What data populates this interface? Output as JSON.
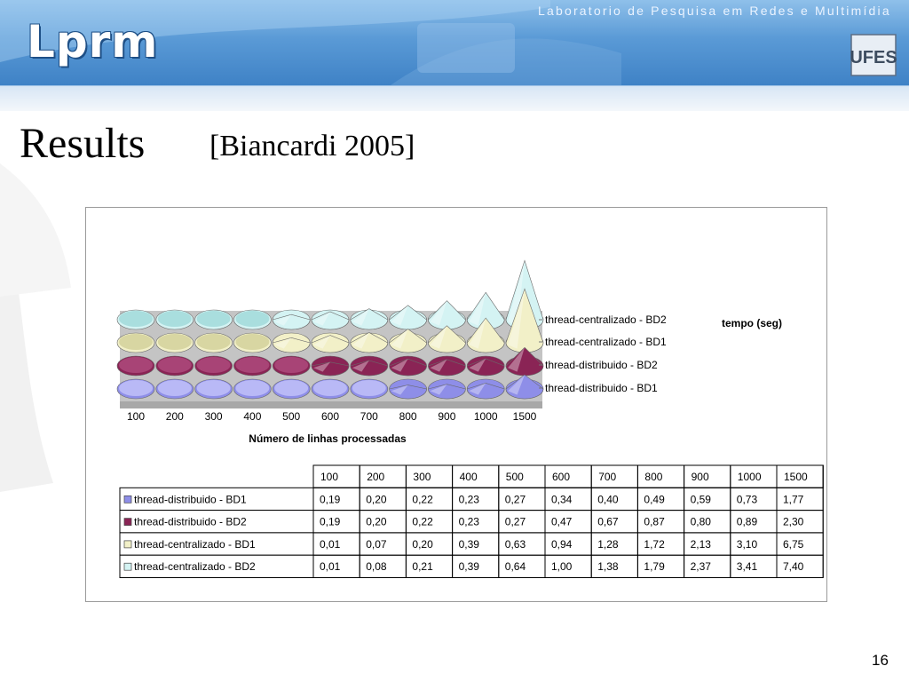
{
  "header": {
    "lab_name": "Laboratorio de Pesquisa em Redes e Multimídia",
    "logo_text": "Lprm",
    "ufes_logo": "UFES"
  },
  "slide": {
    "title": "Results",
    "reference": "[Biancardi 2005]",
    "page_number": "16"
  },
  "chart_data": {
    "type": "3d-cone",
    "categories": [
      "100",
      "200",
      "300",
      "400",
      "500",
      "600",
      "700",
      "800",
      "900",
      "1000",
      "1500"
    ],
    "xlabel": "Número de linhas processadas",
    "zlabel": "tempo (seg)",
    "series": [
      {
        "name": "thread-distribuido - BD1",
        "values": [
          0.19,
          0.2,
          0.22,
          0.23,
          0.27,
          0.34,
          0.4,
          0.49,
          0.59,
          0.73,
          1.77
        ],
        "color": "#8e8ee8",
        "top": "#b9b9f6"
      },
      {
        "name": "thread-distribuido - BD2",
        "values": [
          0.19,
          0.2,
          0.22,
          0.23,
          0.27,
          0.47,
          0.67,
          0.87,
          0.8,
          0.89,
          2.3
        ],
        "color": "#8a2455",
        "top": "#a84476"
      },
      {
        "name": "thread-centralizado - BD1",
        "values": [
          0.01,
          0.07,
          0.2,
          0.39,
          0.63,
          0.94,
          1.28,
          1.72,
          2.13,
          3.1,
          6.75
        ],
        "color": "#f2f0c8",
        "top": "#d8d6a2"
      },
      {
        "name": "thread-centralizado - BD2",
        "values": [
          0.01,
          0.08,
          0.21,
          0.39,
          0.64,
          1.0,
          1.38,
          1.79,
          2.37,
          3.41,
          7.4
        ],
        "color": "#d4f3f3",
        "top": "#a9dede"
      }
    ],
    "table": {
      "header": [
        "100",
        "200",
        "300",
        "400",
        "500",
        "600",
        "700",
        "800",
        "900",
        "1000",
        "1500"
      ],
      "rows": [
        {
          "label": "thread-distribuido - BD1",
          "cells": [
            "0,19",
            "0,20",
            "0,22",
            "0,23",
            "0,27",
            "0,34",
            "0,40",
            "0,49",
            "0,59",
            "0,73",
            "1,77"
          ]
        },
        {
          "label": "thread-distribuido - BD2",
          "cells": [
            "0,19",
            "0,20",
            "0,22",
            "0,23",
            "0,27",
            "0,47",
            "0,67",
            "0,87",
            "0,80",
            "0,89",
            "2,30"
          ]
        },
        {
          "label": "thread-centralizado - BD1",
          "cells": [
            "0,01",
            "0,07",
            "0,20",
            "0,39",
            "0,63",
            "0,94",
            "1,28",
            "1,72",
            "2,13",
            "3,10",
            "6,75"
          ]
        },
        {
          "label": "thread-centralizado - BD2",
          "cells": [
            "0,01",
            "0,08",
            "0,21",
            "0,39",
            "0,64",
            "1,00",
            "1,38",
            "1,79",
            "2,37",
            "3,41",
            "7,40"
          ]
        }
      ]
    },
    "depth_labels_order": "back-to-front"
  }
}
